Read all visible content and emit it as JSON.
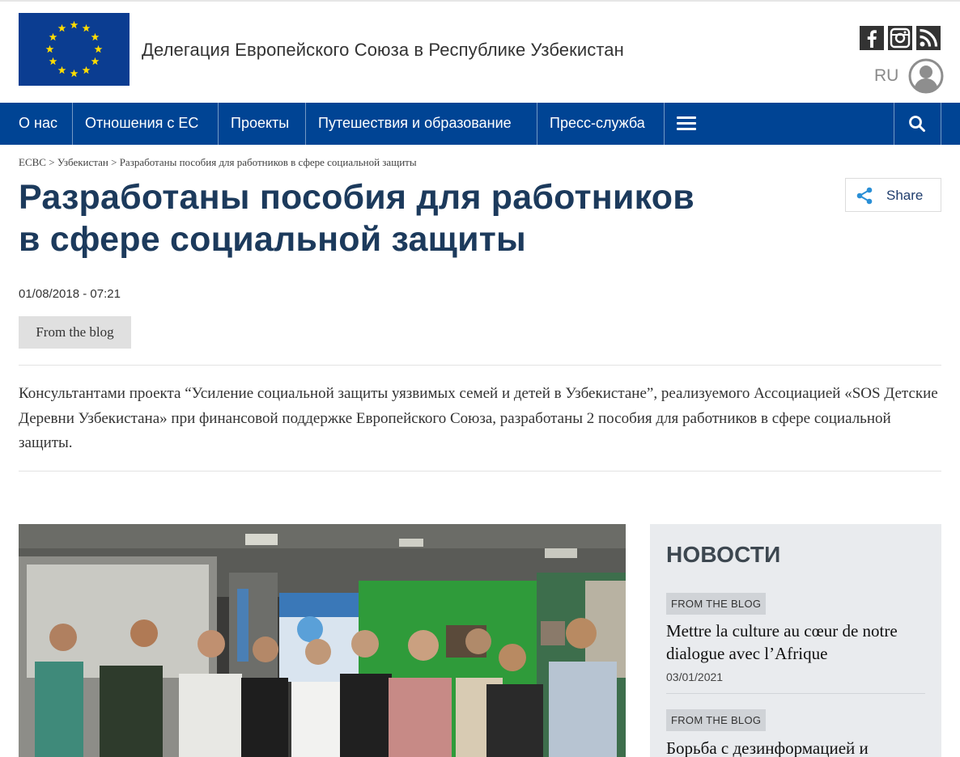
{
  "header": {
    "site_title": "Делегация Европейского Союза в Республике Узбекистан",
    "language": "RU",
    "social_icons": [
      "facebook-icon",
      "instagram-icon",
      "rss-icon"
    ]
  },
  "nav": {
    "items": [
      {
        "label": "О нас"
      },
      {
        "label": "Отношения с ЕС"
      },
      {
        "label": "Проекты"
      },
      {
        "label": "Путешествия и образование"
      },
      {
        "label": "Пресс-служба"
      }
    ]
  },
  "breadcrumb": {
    "items": [
      "ЕСВС",
      "Узбекистан",
      "Разработаны пособия для работников в сфере социальной защиты"
    ],
    "separator": ">"
  },
  "article": {
    "title_line1": "Разработаны пособия для работников",
    "title_line2": "в сфере социальной защиты",
    "share_label": "Share",
    "date": "01/08/2018 - 07:21",
    "tag": "From the blog",
    "lead": "Консультантами проекта “Усиление социальной защиты уязвимых семей и детей в Узбекистане”, реализуемого Ассоциацией «SOS Детские Деревни Узбекистана» при финансовой поддержке Европейского Союза, разработаны 2 пособия для работников в сфере социальной защиты."
  },
  "sidebar": {
    "title": "НОВОСТИ",
    "news": [
      {
        "tag": "FROM THE BLOG",
        "title": "Mettre la culture au cœur de notre dialogue avec l’Afrique",
        "date": "03/01/2021"
      },
      {
        "tag": "FROM THE BLOG",
        "title": "Борьба с дезинформацией и",
        "date": ""
      }
    ]
  },
  "colors": {
    "nav_bg": "#004494",
    "eu_blue": "#0b3d91",
    "eu_gold": "#ffdd00",
    "title_color": "#1c3a5c",
    "share_icon": "#2a8fd6"
  }
}
